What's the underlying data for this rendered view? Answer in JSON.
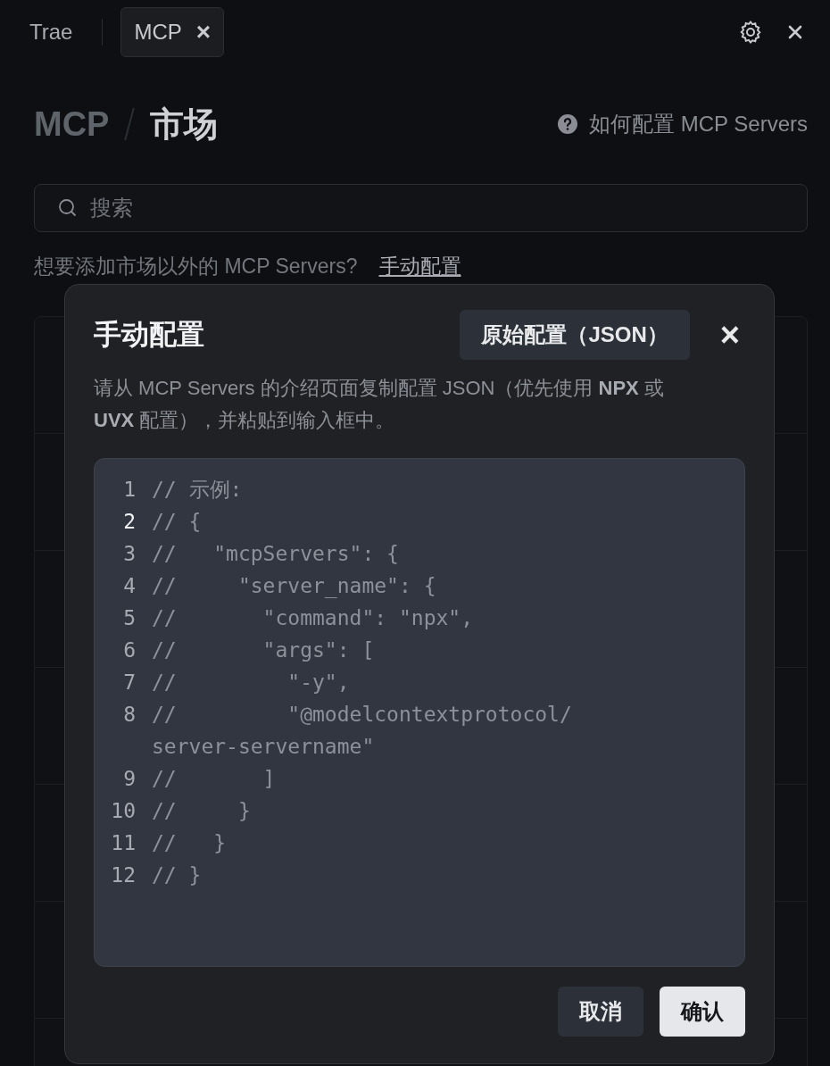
{
  "tabs": [
    {
      "label": "Trae",
      "selected": false,
      "closable": false
    },
    {
      "label": "MCP",
      "selected": true,
      "closable": true,
      "close": "×"
    }
  ],
  "header": {
    "breadcrumb": [
      "MCP",
      "市场"
    ],
    "help_link": "如何配置 MCP Servers"
  },
  "search": {
    "placeholder": "搜索"
  },
  "prompt": {
    "text": "想要添加市场以外的 MCP Servers?",
    "link": "手动配置"
  },
  "dialog": {
    "title": "手动配置",
    "mode_button": "原始配置（JSON）",
    "close": "×",
    "description": "请从 MCP Servers 的介绍页面复制配置 JSON（优先使用 **NPX** 或 **UVX** 配置），并粘贴到输入框中。",
    "code_lines": [
      {
        "number": "1",
        "text": "// 示例:",
        "current": false
      },
      {
        "number": "2",
        "text": "// {",
        "current": true
      },
      {
        "number": "3",
        "text": "//   \"mcpServers\": {",
        "current": false
      },
      {
        "number": "4",
        "text": "//     \"server_name\": {",
        "current": false
      },
      {
        "number": "5",
        "text": "//       \"command\": \"npx\",",
        "current": false
      },
      {
        "number": "6",
        "text": "//       \"args\": [",
        "current": false
      },
      {
        "number": "7",
        "text": "//         \"-y\",",
        "current": false
      },
      {
        "number": "8",
        "text": "//         \"@modelcontextprotocol/",
        "current": false
      },
      {
        "text": "server-servername\""
      },
      {
        "number": "9",
        "text": "//       ]",
        "current": false
      },
      {
        "number": "10",
        "text": "//     }",
        "current": false
      },
      {
        "number": "11",
        "text": "//   }",
        "current": false
      },
      {
        "number": "12",
        "text": "// }",
        "current": false
      }
    ],
    "buttons": [
      {
        "label": "取消",
        "kind": "secondary"
      },
      {
        "label": "确认",
        "kind": "primary"
      }
    ]
  }
}
